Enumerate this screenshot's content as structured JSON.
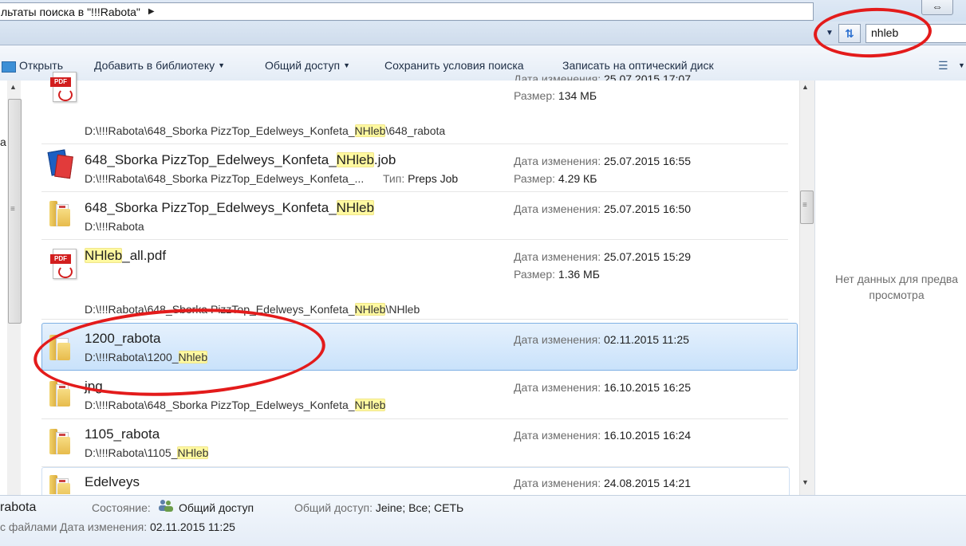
{
  "address": {
    "breadcrumb": "льтаты поиска в \"!!!Rabota\"",
    "search_value": "nhleb"
  },
  "toolbar": {
    "open": "Открыть",
    "add_to_library": "Добавить в библиотеку",
    "share": "Общий доступ",
    "save_search": "Сохранить условия поиска",
    "burn": "Записать на оптический диск"
  },
  "nav": {
    "partial_letter": "a"
  },
  "results": [
    {
      "path_parts": [
        "D:\\!!!Rabota\\648_Sborka PizzTop_Edelweys_Konfeta_",
        "NHleb",
        "\\648_rabota"
      ],
      "meta": [
        {
          "label": "Дата изменения: ",
          "value": "25.07.2015 17:07"
        },
        {
          "label": "Размер: ",
          "value": "134 МБ"
        }
      ]
    },
    {
      "name_parts": [
        "648_Sborka PizzTop_Edelweys_Konfeta_",
        "NHleb",
        ".job"
      ],
      "path_parts": [
        "D:\\!!!Rabota\\648_Sborka PizzTop_Edelweys_Konfeta_..."
      ],
      "type": {
        "label": "Тип: ",
        "value": "Preps Job"
      },
      "meta": [
        {
          "label": "Дата изменения: ",
          "value": "25.07.2015 16:55"
        },
        {
          "label": "Размер: ",
          "value": "4.29 КБ"
        }
      ]
    },
    {
      "name_parts": [
        "648_Sborka PizzTop_Edelweys_Konfeta_",
        "NHleb",
        ""
      ],
      "path_parts": [
        "D:\\!!!Rabota"
      ],
      "meta": [
        {
          "label": "Дата изменения: ",
          "value": "25.07.2015 16:50"
        }
      ]
    },
    {
      "name_parts": [
        "",
        "NHleb",
        "_all.pdf"
      ],
      "path_parts": [
        "D:\\!!!Rabota\\648_Sborka PizzTop_Edelweys_Konfeta_",
        "NHleb",
        "\\NHleb"
      ],
      "meta": [
        {
          "label": "Дата изменения: ",
          "value": "25.07.2015 15:29"
        },
        {
          "label": "Размер: ",
          "value": "1.36 МБ"
        }
      ]
    },
    {
      "name_parts": [
        "1200_rabota"
      ],
      "path_parts": [
        "D:\\!!!Rabota\\1200_",
        "Nhleb",
        ""
      ],
      "meta": [
        {
          "label": "Дата изменения: ",
          "value": "02.11.2015 11:25"
        }
      ]
    },
    {
      "name_parts": [
        "jpg"
      ],
      "path_parts": [
        "D:\\!!!Rabota\\648_Sborka PizzTop_Edelweys_Konfeta_",
        "NHleb",
        ""
      ],
      "meta": [
        {
          "label": "Дата изменения: ",
          "value": "16.10.2015 16:25"
        }
      ]
    },
    {
      "name_parts": [
        "1105_rabota"
      ],
      "path_parts": [
        "D:\\!!!Rabota\\1105_",
        "NHleb",
        ""
      ],
      "meta": [
        {
          "label": "Дата изменения: ",
          "value": "16.10.2015 16:24"
        }
      ]
    },
    {
      "name_parts": [
        "Edelveys"
      ],
      "meta": [
        {
          "label": "Дата изменения: ",
          "value": "24.08.2015 14:21"
        }
      ]
    }
  ],
  "preview": {
    "line1": "Нет данных для предва",
    "line2": "просмотра"
  },
  "details": {
    "name": "rabota",
    "state_label": "Состояние:",
    "state_value": "Общий доступ",
    "shared_label": "Общий доступ:",
    "shared_value": "Jeine; Все; СЕТЬ",
    "kind": "с файлами",
    "date_label": "Дата изменения:",
    "date_value": "02.11.2015 11:25"
  },
  "colors": {
    "highlight": "#fff9a0",
    "annotation": "#e31b1b",
    "selection": "#c9e2fb"
  }
}
